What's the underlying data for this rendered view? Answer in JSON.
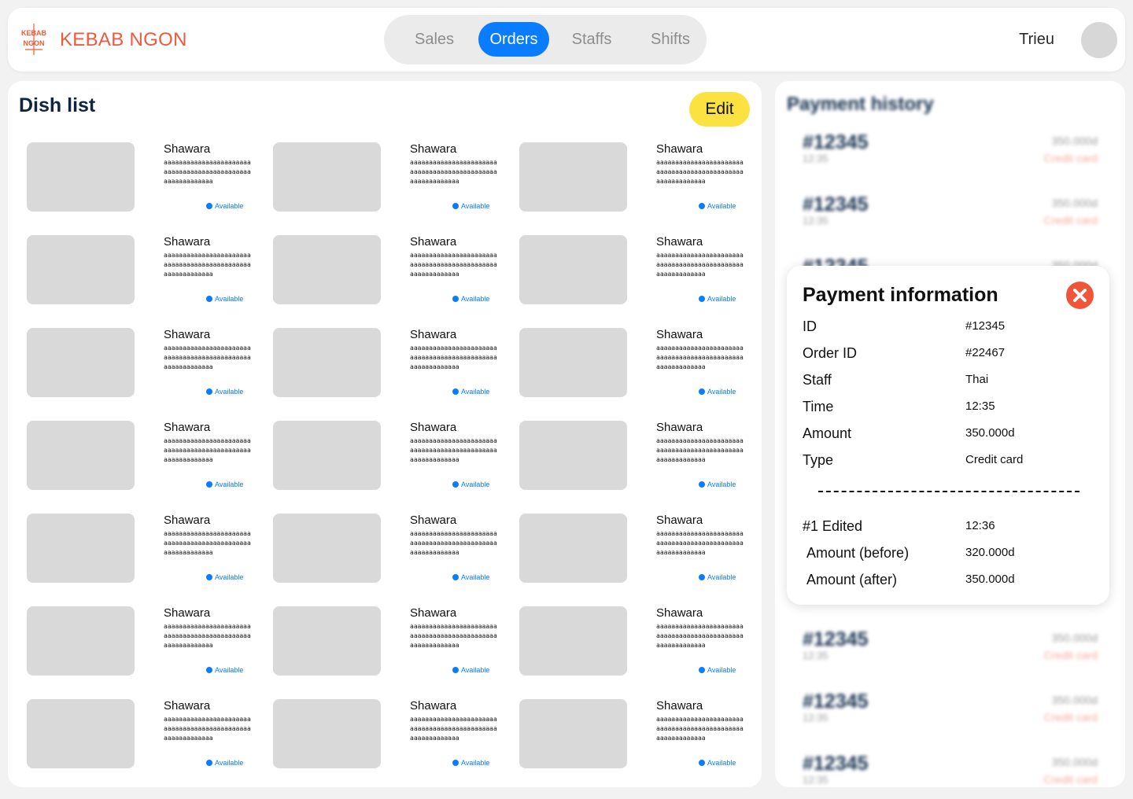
{
  "header": {
    "logo_text": "KEBAB NGON",
    "brand": "KEBAB NGON",
    "nav": [
      {
        "label": "Sales",
        "active": false
      },
      {
        "label": "Orders",
        "active": true
      },
      {
        "label": "Staffs",
        "active": false
      },
      {
        "label": "Shifts",
        "active": false
      }
    ],
    "user": {
      "name": "Trieu"
    },
    "accent_color": "#0a7cff",
    "brand_color": "#ee5a3b"
  },
  "dish_list": {
    "title": "Dish list",
    "edit_label": "Edit",
    "dishes": [
      {
        "name": "Shawara",
        "description": "aaaaaaaaaaaaaaaaaaaaaaaaaaaaaaaaaaaaaaaaaaaaaaaaaaaaaaaaaaa",
        "status": "Available"
      },
      {
        "name": "Shawara",
        "description": "aaaaaaaaaaaaaaaaaaaaaaaaaaaaaaaaaaaaaaaaaaaaaaaaaaaaaaaaaaa",
        "status": "Available"
      },
      {
        "name": "Shawara",
        "description": "aaaaaaaaaaaaaaaaaaaaaaaaaaaaaaaaaaaaaaaaaaaaaaaaaaaaaaaaaaa",
        "status": "Available"
      },
      {
        "name": "Shawara",
        "description": "aaaaaaaaaaaaaaaaaaaaaaaaaaaaaaaaaaaaaaaaaaaaaaaaaaaaaaaaaaa",
        "status": "Available"
      },
      {
        "name": "Shawara",
        "description": "aaaaaaaaaaaaaaaaaaaaaaaaaaaaaaaaaaaaaaaaaaaaaaaaaaaaaaaaaaa",
        "status": "Available"
      },
      {
        "name": "Shawara",
        "description": "aaaaaaaaaaaaaaaaaaaaaaaaaaaaaaaaaaaaaaaaaaaaaaaaaaaaaaaaaaa",
        "status": "Available"
      },
      {
        "name": "Shawara",
        "description": "aaaaaaaaaaaaaaaaaaaaaaaaaaaaaaaaaaaaaaaaaaaaaaaaaaaaaaaaaaa",
        "status": "Available"
      },
      {
        "name": "Shawara",
        "description": "aaaaaaaaaaaaaaaaaaaaaaaaaaaaaaaaaaaaaaaaaaaaaaaaaaaaaaaaaaa",
        "status": "Available"
      },
      {
        "name": "Shawara",
        "description": "aaaaaaaaaaaaaaaaaaaaaaaaaaaaaaaaaaaaaaaaaaaaaaaaaaaaaaaaaaa",
        "status": "Available"
      },
      {
        "name": "Shawara",
        "description": "aaaaaaaaaaaaaaaaaaaaaaaaaaaaaaaaaaaaaaaaaaaaaaaaaaaaaaaaaaa",
        "status": "Available"
      },
      {
        "name": "Shawara",
        "description": "aaaaaaaaaaaaaaaaaaaaaaaaaaaaaaaaaaaaaaaaaaaaaaaaaaaaaaaaaaa",
        "status": "Available"
      },
      {
        "name": "Shawara",
        "description": "aaaaaaaaaaaaaaaaaaaaaaaaaaaaaaaaaaaaaaaaaaaaaaaaaaaaaaaaaaa",
        "status": "Available"
      },
      {
        "name": "Shawara",
        "description": "aaaaaaaaaaaaaaaaaaaaaaaaaaaaaaaaaaaaaaaaaaaaaaaaaaaaaaaaaaa",
        "status": "Available"
      },
      {
        "name": "Shawara",
        "description": "aaaaaaaaaaaaaaaaaaaaaaaaaaaaaaaaaaaaaaaaaaaaaaaaaaaaaaaaaaa",
        "status": "Available"
      },
      {
        "name": "Shawara",
        "description": "aaaaaaaaaaaaaaaaaaaaaaaaaaaaaaaaaaaaaaaaaaaaaaaaaaaaaaaaaaa",
        "status": "Available"
      },
      {
        "name": "Shawara",
        "description": "aaaaaaaaaaaaaaaaaaaaaaaaaaaaaaaaaaaaaaaaaaaaaaaaaaaaaaaaaaa",
        "status": "Available"
      },
      {
        "name": "Shawara",
        "description": "aaaaaaaaaaaaaaaaaaaaaaaaaaaaaaaaaaaaaaaaaaaaaaaaaaaaaaaaaaa",
        "status": "Available"
      },
      {
        "name": "Shawara",
        "description": "aaaaaaaaaaaaaaaaaaaaaaaaaaaaaaaaaaaaaaaaaaaaaaaaaaaaaaaaaaa",
        "status": "Available"
      },
      {
        "name": "Shawara",
        "description": "aaaaaaaaaaaaaaaaaaaaaaaaaaaaaaaaaaaaaaaaaaaaaaaaaaaaaaaaaaa",
        "status": "Available"
      },
      {
        "name": "Shawara",
        "description": "aaaaaaaaaaaaaaaaaaaaaaaaaaaaaaaaaaaaaaaaaaaaaaaaaaaaaaaaaaa",
        "status": "Available"
      },
      {
        "name": "Shawara",
        "description": "aaaaaaaaaaaaaaaaaaaaaaaaaaaaaaaaaaaaaaaaaaaaaaaaaaaaaaaaaaa",
        "status": "Available"
      }
    ]
  },
  "payment_history": {
    "title": "Payment history",
    "rows": [
      {
        "id": "#12345",
        "time": "12:35",
        "amount": "350.000d",
        "type": "Credit card"
      },
      {
        "id": "#12345",
        "time": "12:35",
        "amount": "350.000d",
        "type": "Credit card"
      },
      {
        "id": "#12345",
        "time": "12:35",
        "amount": "350.000d",
        "type": "Credit card"
      },
      {
        "id": "#12345",
        "time": "12:35",
        "amount": "350.000d",
        "type": "Credit card"
      },
      {
        "id": "#12345",
        "time": "12:35",
        "amount": "350.000d",
        "type": "Credit card"
      },
      {
        "id": "#12345",
        "time": "12:35",
        "amount": "350.000d",
        "type": "Credit card"
      }
    ]
  },
  "payment_info": {
    "title": "Payment information",
    "fields": [
      {
        "label": "ID",
        "value": "#12345"
      },
      {
        "label": "Order ID",
        "value": "#22467"
      },
      {
        "label": "Staff",
        "value": "Thai"
      },
      {
        "label": "Time",
        "value": "12:35"
      },
      {
        "label": "Amount",
        "value": "350.000d"
      },
      {
        "label": "Type",
        "value": "Credit card"
      }
    ],
    "edits": [
      {
        "label": "#1 Edited",
        "value": "12:36"
      },
      {
        "label": "Amount (before)",
        "value": "320.000d"
      },
      {
        "label": "Amount (after)",
        "value": "350.000d"
      }
    ]
  }
}
